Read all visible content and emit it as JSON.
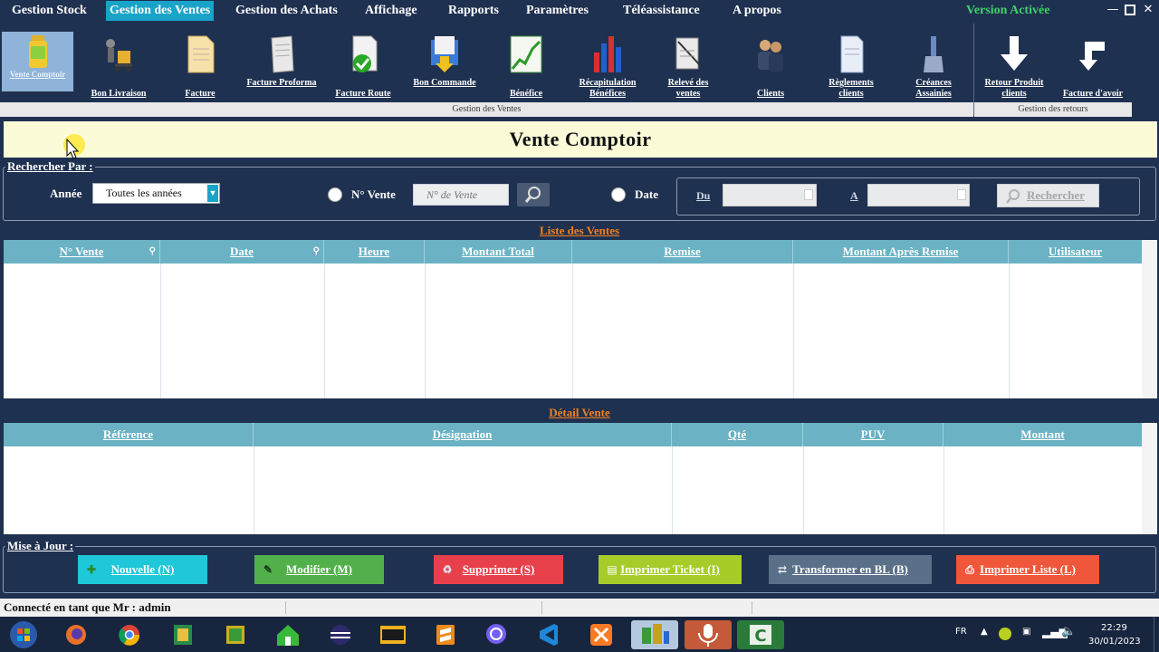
{
  "menubar": {
    "items": [
      "Gestion  Stock",
      "Gestion des Ventes",
      "Gestion des Achats",
      "Affichage",
      "Rapports",
      "Paramètres",
      "Téléassistance",
      "A propos"
    ],
    "version": "Version Activée"
  },
  "ribbon": {
    "buttons": [
      {
        "label": "Vente Comptoir",
        "icon": "jar-icon"
      },
      {
        "label": "Bon Livraison",
        "icon": "delivery-trolley-icon"
      },
      {
        "label": "Facture",
        "icon": "document-icon"
      },
      {
        "label": "Facture Proforma",
        "icon": "document-scroll-icon"
      },
      {
        "label": "Facture Route",
        "icon": "document-check-icon"
      },
      {
        "label": "Bon Commande",
        "icon": "order-icon"
      },
      {
        "label": "Bénéfice",
        "icon": "line-chart-icon"
      },
      {
        "label": "Récapitulation Bénéfices",
        "icon": "bar-chart-icon"
      },
      {
        "label": "Relevé des ventes",
        "icon": "statement-icon"
      },
      {
        "label": "Clients",
        "icon": "people-icon"
      },
      {
        "label": "Règlements clients",
        "icon": "payment-document-icon"
      },
      {
        "label": "Créances Assainies",
        "icon": "brush-icon"
      },
      {
        "label": "Retour Produit clients",
        "icon": "arrow-down-icon"
      },
      {
        "label": "Facture d'avoir",
        "icon": "arrow-return-icon"
      }
    ],
    "group_ventes": "Gestion des Ventes",
    "group_retours": "Gestion des retours"
  },
  "page": {
    "title": "Vente Comptoir"
  },
  "search": {
    "legend": "Rechercher Par :",
    "annee_label": "Année",
    "annee_value": "Toutes les années",
    "num_vente_label": "N° Vente",
    "num_vente_placeholder": "N° de Vente",
    "date_label": "Date",
    "du_label": "Du",
    "a_label": "A",
    "rechercher": "Rechercher"
  },
  "ventes": {
    "title": "Liste des Ventes",
    "columns": [
      "N° Vente",
      "Date",
      "Heure",
      "Montant Total",
      "Remise",
      "Montant Après Remise",
      "Utilisateur"
    ],
    "rows": []
  },
  "detail": {
    "title": "Détail Vente",
    "columns": [
      "Référence",
      "Désignation",
      "Qté",
      "PUV",
      "Montant"
    ],
    "rows": []
  },
  "actions": {
    "legend": "Mise à Jour :",
    "buttons": [
      {
        "label": "Nouvelle (N)",
        "color": "#1ec8d8"
      },
      {
        "label": "Modifier (M)",
        "color": "#52b04a"
      },
      {
        "label": "Supprimer (S)",
        "color": "#e8404a"
      },
      {
        "label": "Imprimer Ticket (I)",
        "color": "#a6cc2a"
      },
      {
        "label": "Transformer en BL (B)",
        "color": "#5a7088"
      },
      {
        "label": "Imprimer Liste (L)",
        "color": "#f0563a"
      }
    ]
  },
  "status": {
    "text": "Connecté en tant que Mr : admin"
  },
  "taskbar": {
    "lang": "FR",
    "time": "22:29",
    "date": "30/01/2023"
  }
}
